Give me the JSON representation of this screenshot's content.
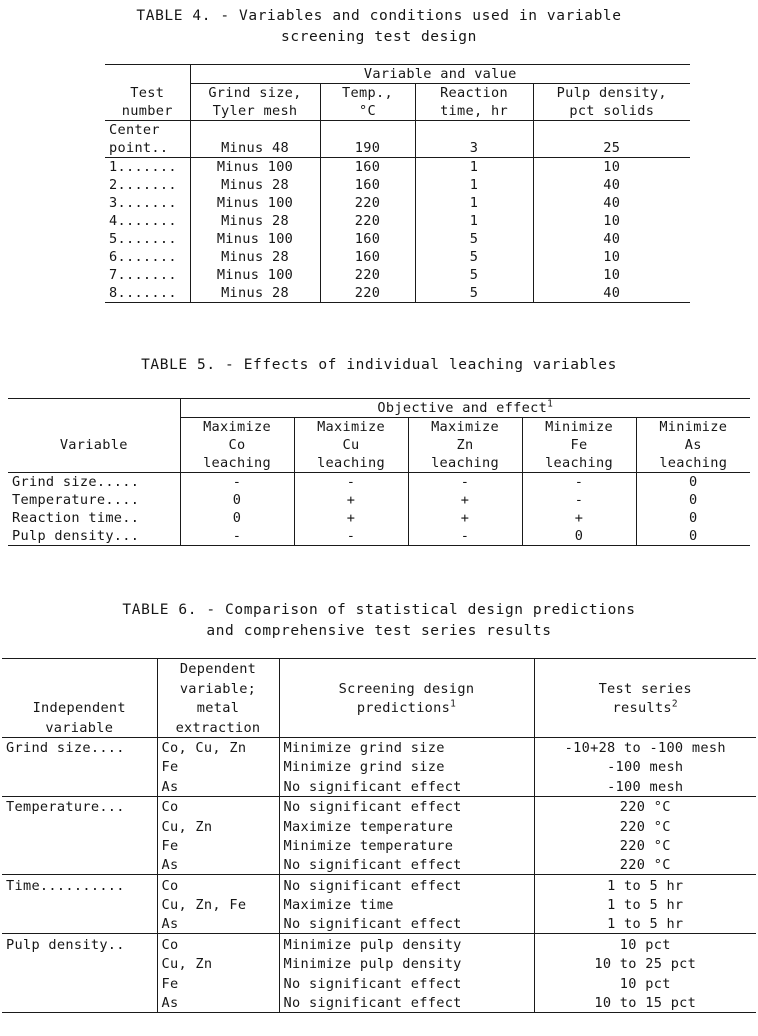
{
  "table4": {
    "caption_lines": [
      "TABLE 4. - Variables and conditions used in variable",
      "screening test design"
    ],
    "spanner": "Variable and value",
    "headers": {
      "test": [
        "Test",
        "number"
      ],
      "grind": [
        "Grind size,",
        "Tyler mesh"
      ],
      "temp": [
        "Temp.,",
        "°C"
      ],
      "reaction": [
        "Reaction",
        "time, hr"
      ],
      "pulp": [
        "Pulp density,",
        "pct solids"
      ]
    },
    "rows": [
      {
        "test_l1": "Center",
        "test_l2": "point..",
        "grind": "Minus 48",
        "temp": "190",
        "reaction": "3",
        "pulp": "25"
      },
      {
        "test_l1": "",
        "test_l2": "1.......",
        "grind": "Minus 100",
        "temp": "160",
        "reaction": "1",
        "pulp": "10"
      },
      {
        "test_l1": "",
        "test_l2": "2.......",
        "grind": "Minus 28",
        "temp": "160",
        "reaction": "1",
        "pulp": "40"
      },
      {
        "test_l1": "",
        "test_l2": "3.......",
        "grind": "Minus 100",
        "temp": "220",
        "reaction": "1",
        "pulp": "40"
      },
      {
        "test_l1": "",
        "test_l2": "4.......",
        "grind": "Minus 28",
        "temp": "220",
        "reaction": "1",
        "pulp": "10"
      },
      {
        "test_l1": "",
        "test_l2": "5.......",
        "grind": "Minus 100",
        "temp": "160",
        "reaction": "5",
        "pulp": "40"
      },
      {
        "test_l1": "",
        "test_l2": "6.......",
        "grind": "Minus 28",
        "temp": "160",
        "reaction": "5",
        "pulp": "10"
      },
      {
        "test_l1": "",
        "test_l2": "7.......",
        "grind": "Minus 100",
        "temp": "220",
        "reaction": "5",
        "pulp": "10"
      },
      {
        "test_l1": "",
        "test_l2": "8.......",
        "grind": "Minus 28",
        "temp": "220",
        "reaction": "5",
        "pulp": "40"
      }
    ]
  },
  "table5": {
    "caption_lines": [
      "TABLE 5. - Effects of individual leaching variables"
    ],
    "spanner": "Objective and effect",
    "spanner_footnote": "1",
    "stub_header": "Variable",
    "headers": [
      [
        "Maximize",
        "Co",
        "leaching"
      ],
      [
        "Maximize",
        "Cu",
        "leaching"
      ],
      [
        "Maximize",
        "Zn",
        "leaching"
      ],
      [
        "Minimize",
        "Fe",
        "leaching"
      ],
      [
        "Minimize",
        "As",
        "leaching"
      ]
    ],
    "rows": [
      {
        "variable": "Grind size.....",
        "values": [
          "-",
          "-",
          "-",
          "-",
          "0"
        ]
      },
      {
        "variable": "Temperature....",
        "values": [
          "0",
          "+",
          "+",
          "-",
          "0"
        ]
      },
      {
        "variable": "Reaction time..",
        "values": [
          "0",
          "+",
          "+",
          "+",
          "0"
        ]
      },
      {
        "variable": "Pulp density...",
        "values": [
          "-",
          "-",
          "-",
          "0",
          "0"
        ]
      }
    ]
  },
  "table6": {
    "caption_lines": [
      "TABLE 6. - Comparison of statistical design predictions",
      "and comprehensive test series results"
    ],
    "headers": {
      "independent": [
        "Independent",
        "variable"
      ],
      "dependent": [
        "Dependent",
        "variable;",
        "metal",
        "extraction"
      ],
      "screening": [
        "Screening design",
        "predictions"
      ],
      "screening_footnote": "1",
      "results": [
        "Test series",
        "results"
      ],
      "results_footnote": "2"
    },
    "groups": [
      {
        "variable": "Grind size....",
        "rows": [
          {
            "dependent": "Co, Cu, Zn",
            "prediction": "Minimize grind size",
            "result": "-10+28 to -100 mesh"
          },
          {
            "dependent": "Fe",
            "prediction": "Minimize grind size",
            "result": "-100 mesh"
          },
          {
            "dependent": "As",
            "prediction": "No significant effect",
            "result": "-100 mesh"
          }
        ]
      },
      {
        "variable": "Temperature...",
        "rows": [
          {
            "dependent": "Co",
            "prediction": "No significant effect",
            "result": "220 °C"
          },
          {
            "dependent": "Cu, Zn",
            "prediction": "Maximize temperature",
            "result": "220 °C"
          },
          {
            "dependent": "Fe",
            "prediction": "Minimize temperature",
            "result": "220 °C"
          },
          {
            "dependent": "As",
            "prediction": "No significant effect",
            "result": "220 °C"
          }
        ]
      },
      {
        "variable": "Time..........",
        "rows": [
          {
            "dependent": "Co",
            "prediction": "No significant effect",
            "result": "1 to 5 hr"
          },
          {
            "dependent": "Cu, Zn, Fe",
            "prediction": "Maximize time",
            "result": "1 to 5 hr"
          },
          {
            "dependent": "As",
            "prediction": "No significant effect",
            "result": "1 to 5 hr"
          }
        ]
      },
      {
        "variable": "Pulp density..",
        "rows": [
          {
            "dependent": "Co",
            "prediction": "Minimize pulp density",
            "result": "10 pct"
          },
          {
            "dependent": "Cu, Zn",
            "prediction": "Minimize pulp density",
            "result": "10 to 25 pct"
          },
          {
            "dependent": "Fe",
            "prediction": "No significant effect",
            "result": "10 pct"
          },
          {
            "dependent": "As",
            "prediction": "No significant effect",
            "result": "10 to 15 pct"
          }
        ]
      }
    ]
  }
}
